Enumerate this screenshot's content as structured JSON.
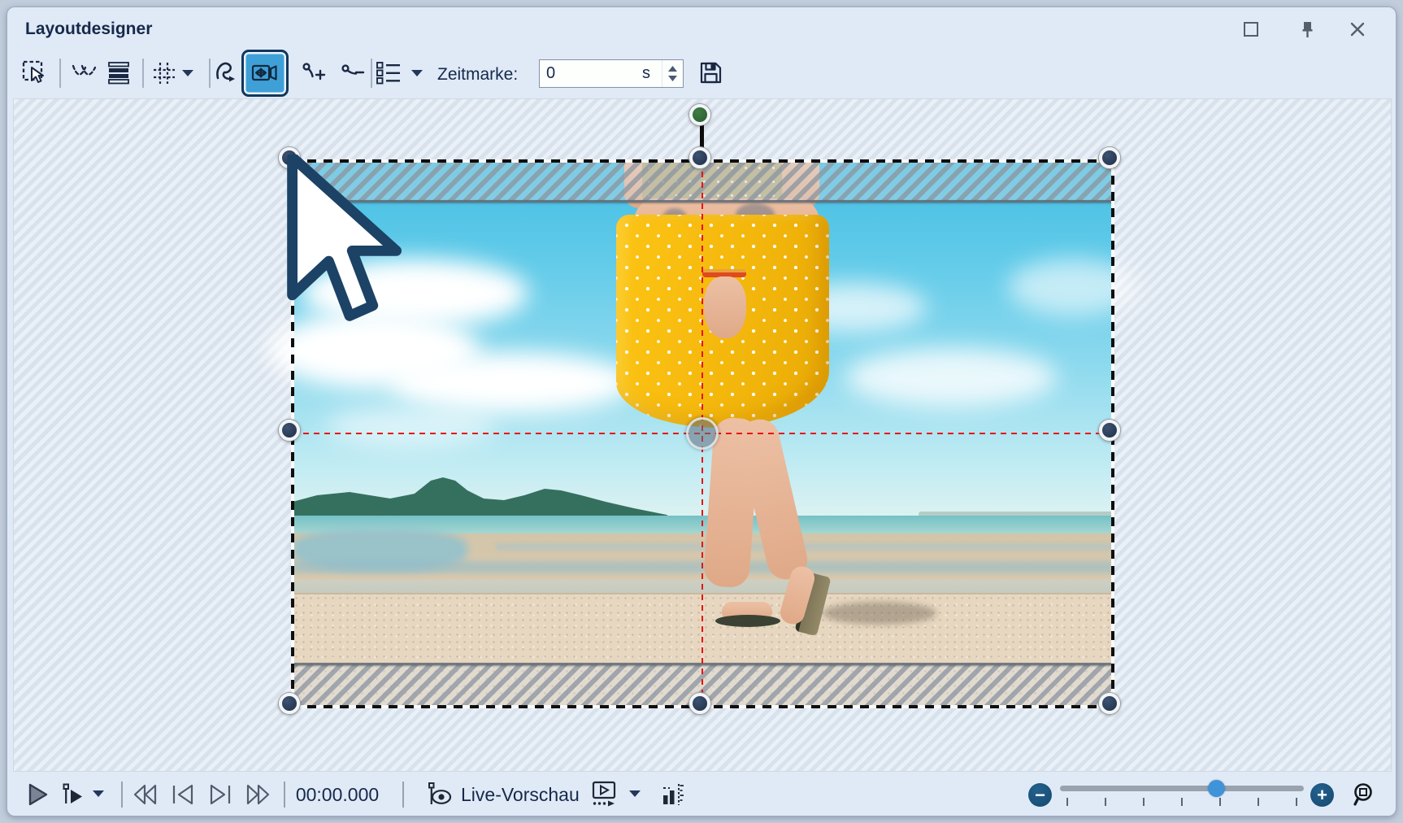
{
  "window": {
    "title": "Layoutdesigner",
    "controls": [
      {
        "name": "maximize"
      },
      {
        "name": "pin"
      },
      {
        "name": "close"
      }
    ]
  },
  "toolbar": {
    "tools": [
      {
        "name": "select",
        "active": false
      },
      {
        "name": "path",
        "active": false
      },
      {
        "name": "stack-order",
        "active": false
      },
      {
        "name": "grid",
        "active": false,
        "dropdown": true
      },
      {
        "name": "motion-curve",
        "active": false
      },
      {
        "name": "camera-pan",
        "active": true
      },
      {
        "name": "add-keyframe",
        "active": false
      },
      {
        "name": "remove-keyframe",
        "active": false
      },
      {
        "name": "object-list",
        "active": false,
        "dropdown": true
      },
      {
        "name": "save",
        "active": false
      }
    ],
    "timemark": {
      "label": "Zeitmarke:",
      "value": "0",
      "unit": "s"
    }
  },
  "transport": {
    "time_display": "00:00.000",
    "live_preview_label": "Live-Vorschau"
  },
  "zoom_control": {
    "percent": 64,
    "tick_count": 7
  },
  "selection": {
    "handle_color": "#2a3c58",
    "rotation_handle_color": "#2f6b35",
    "crosshair_color": "#e81313",
    "active_tool_fill": "#3fa0d8",
    "active_tool_border": "#12375c"
  }
}
